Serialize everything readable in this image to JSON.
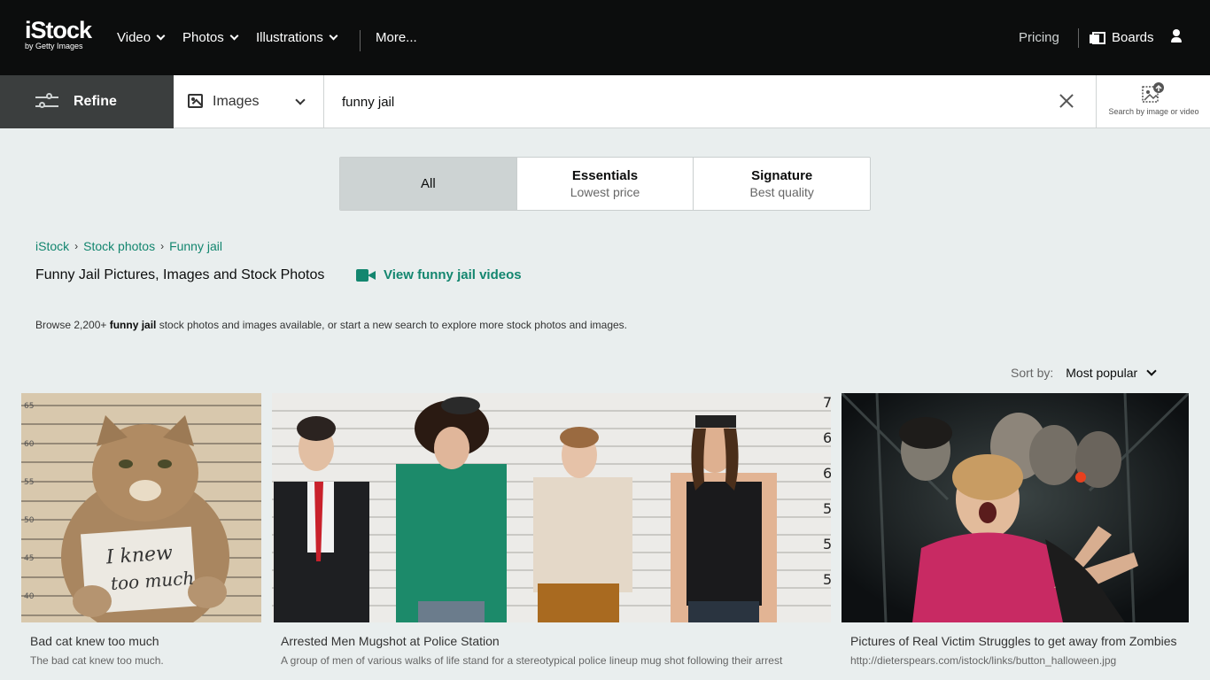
{
  "brand": {
    "name": "iStock",
    "sub": "by Getty Images"
  },
  "nav": {
    "items": [
      {
        "label": "Video"
      },
      {
        "label": "Photos"
      },
      {
        "label": "Illustrations"
      }
    ],
    "more": "More...",
    "pricing": "Pricing",
    "boards": "Boards"
  },
  "search": {
    "refine": "Refine",
    "media_type": "Images",
    "query": "funny jail",
    "search_by_image": "Search by image or video"
  },
  "tabs": [
    {
      "title": "All",
      "subtitle": ""
    },
    {
      "title": "Essentials",
      "subtitle": "Lowest price"
    },
    {
      "title": "Signature",
      "subtitle": "Best quality"
    }
  ],
  "breadcrumb": [
    "iStock",
    "Stock photos",
    "Funny jail"
  ],
  "page_title": "Funny Jail Pictures, Images and Stock Photos",
  "videos_link": "View funny jail videos",
  "browse": {
    "prefix": "Browse 2,200+ ",
    "term": "funny jail",
    "suffix": " stock photos and images available, or start a new search to explore more stock photos and images."
  },
  "sort": {
    "label": "Sort by:",
    "value": "Most popular"
  },
  "results": [
    {
      "title": "Bad cat knew too much",
      "description": "The bad cat knew too much.",
      "sign_text_1": "I knew",
      "sign_text_2": "too much"
    },
    {
      "title": "Arrested Men Mugshot at Police Station",
      "description": "A group of men of various walks of life stand for a stereotypical police lineup mug shot following their arrest"
    },
    {
      "title": "Pictures of Real Victim Struggles to get away from Zombies",
      "description": "http://dieterspears.com/istock/links/button_halloween.jpg"
    }
  ],
  "colors": {
    "accent": "#13866f",
    "nav_bg": "#0c0d0d",
    "refine_bg": "#3b3e3e",
    "page_bg": "#e9eeee"
  }
}
